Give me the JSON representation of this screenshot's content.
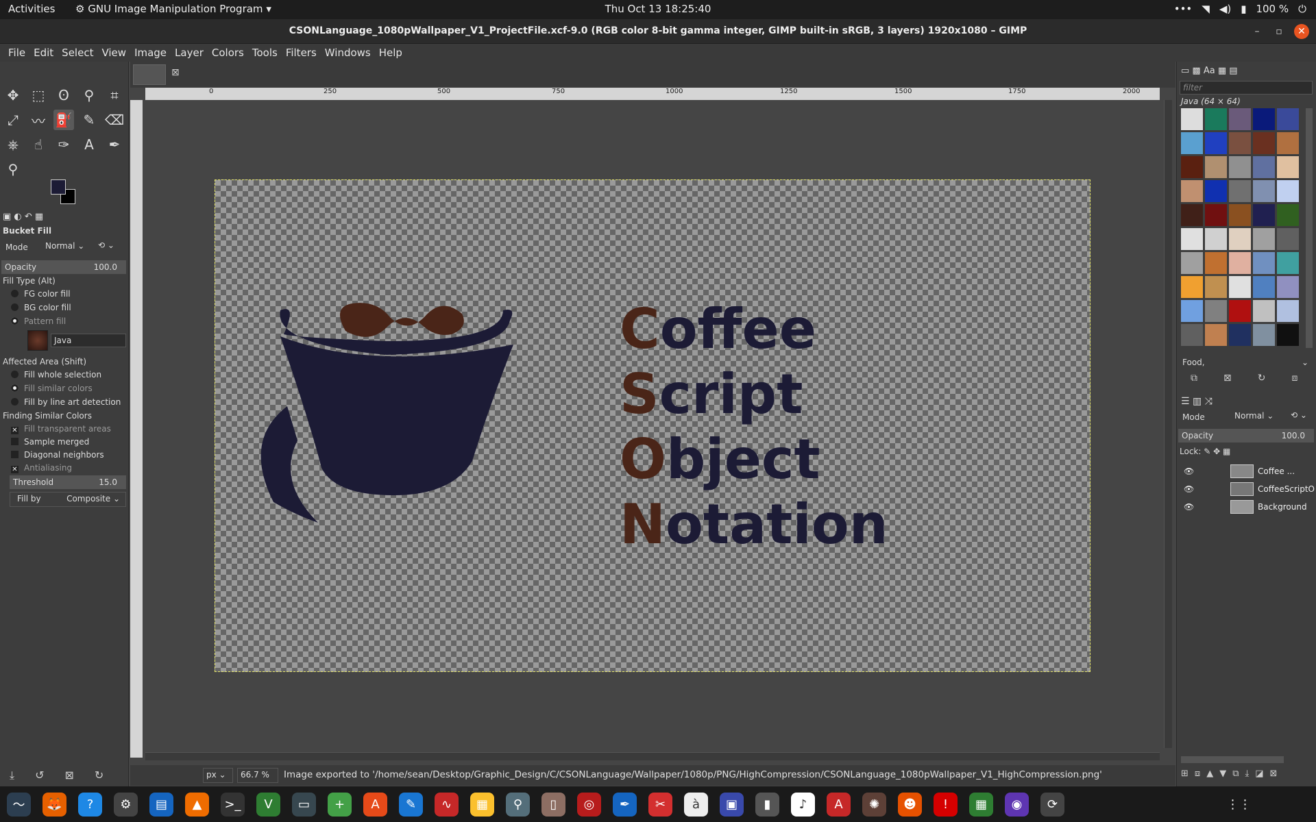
{
  "topbar": {
    "activities": "Activities",
    "app_menu": "GNU Image Manipulation Program",
    "clock": "Thu Oct 13  18:25:40",
    "battery": "100 %"
  },
  "window": {
    "title": "CSONLanguage_1080pWallpaper_V1_ProjectFile.xcf-9.0 (RGB color 8-bit gamma integer, GIMP built-in sRGB, 3 layers) 1920x1080 – GIMP"
  },
  "menu": [
    "File",
    "Edit",
    "Select",
    "View",
    "Image",
    "Layer",
    "Colors",
    "Tools",
    "Filters",
    "Windows",
    "Help"
  ],
  "tool_options": {
    "tool_name": "Bucket Fill",
    "mode_label": "Mode",
    "mode_value": "Normal",
    "opacity_label": "Opacity",
    "opacity_value": "100.0",
    "fill_type_label": "Fill Type  (Alt)",
    "fill_types": [
      "FG color fill",
      "BG color fill",
      "Pattern fill"
    ],
    "pattern_name": "Java",
    "affected_label": "Affected Area  (Shift)",
    "affected": [
      "Fill whole selection",
      "Fill similar colors",
      "Fill by line art detection"
    ],
    "finding_label": "Finding Similar Colors",
    "finding": [
      "Fill transparent areas",
      "Sample merged",
      "Diagonal neighbors",
      "Antialiasing"
    ],
    "threshold_label": "Threshold",
    "threshold_value": "15.0",
    "fillby_label": "Fill by",
    "fillby_value": "Composite"
  },
  "ruler_ticks": [
    "0",
    "250",
    "500",
    "750",
    "1000",
    "1250",
    "1500",
    "1750",
    "2000"
  ],
  "logo": {
    "words": [
      {
        "cap": "C",
        "rest": "offee"
      },
      {
        "cap": "S",
        "rest": "cript"
      },
      {
        "cap": "O",
        "rest": "bject"
      },
      {
        "cap": "N",
        "rest": "otation"
      }
    ]
  },
  "status": {
    "unit": "px",
    "zoom": "66.7 %",
    "message": "Image exported to '/home/sean/Desktop/Graphic_Design/C/CSONLanguage/Wallpaper/1080p/PNG/HighCompression/CSONLanguage_1080pWallpaper_V1_HighCompression.png'"
  },
  "patterns_panel": {
    "filter_placeholder": "filter",
    "current": "Java (64 × 64)",
    "tag": "Food,"
  },
  "layers_panel": {
    "mode_label": "Mode",
    "mode_value": "Normal",
    "opacity_label": "Opacity",
    "opacity_value": "100.0",
    "lock_label": "Lock:",
    "layers": [
      "Coffee ...",
      "CoffeeScriptO",
      "Background"
    ]
  },
  "colors": {
    "fg": "#1c1b35",
    "bg": "#000000",
    "accent": "#e95420"
  }
}
